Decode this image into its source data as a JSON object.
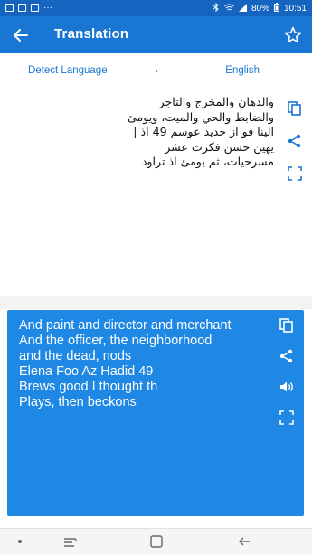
{
  "status_bar": {
    "battery": "80%",
    "time": "10:51",
    "more": "···"
  },
  "toolbar": {
    "title": "Translation"
  },
  "language_bar": {
    "source_language": "Detect Language",
    "arrow": "→",
    "target_language": "English"
  },
  "source": {
    "text": "والدهان والمخرج والتاجر\nوالضابط والحي والميت، ويومئ\nالينا فو از حديد عوسم 49 اذ |\nيهين حسن فكرت عشر\nمسرحيات، ثم يومئ اذ تراود"
  },
  "result": {
    "text": "And paint and director and merchant\nAnd the officer, the neighborhood\nand the dead, nods\nElena Foo Az Hadid 49\nBrews good I thought th\nPlays, then beckons"
  },
  "colors": {
    "status_bar": "#1565c0",
    "toolbar": "#1976d2",
    "accent": "#1976d2",
    "result_card": "#1f88e5"
  }
}
